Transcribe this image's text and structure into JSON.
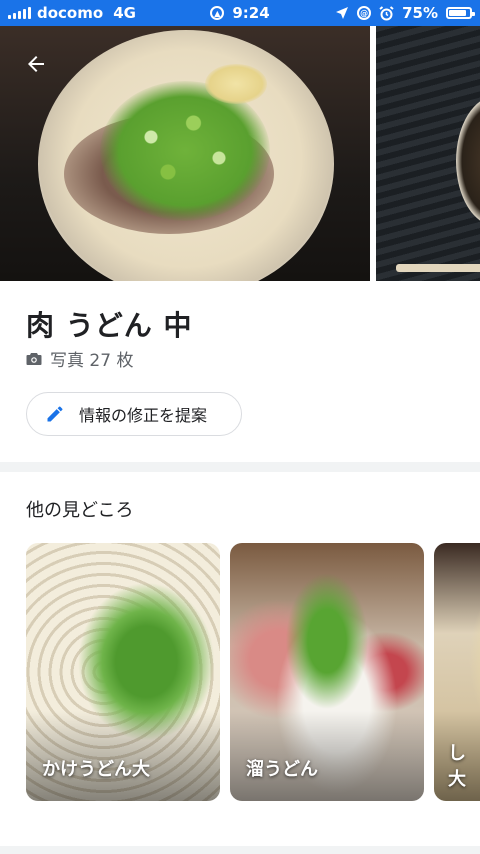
{
  "status_bar": {
    "carrier": "docomo",
    "network": "4G",
    "time": "9:24",
    "battery": "75%",
    "battery_level": 0.75,
    "icons": [
      "signal-bars-icon",
      "nav-arrow-icon",
      "location-arrow-icon",
      "lock-rotation-icon",
      "alarm-icon",
      "battery-icon"
    ]
  },
  "hero": {
    "back_icon": "back-arrow-icon"
  },
  "place": {
    "title": "肉 うどん 中",
    "photos_label": "写真 27 枚",
    "photos_icon": "camera-icon"
  },
  "suggest_button": {
    "label": "情報の修正を提案",
    "icon": "pencil-icon",
    "accent": "#1a73e8"
  },
  "other_spots": {
    "title": "他の見どころ",
    "cards": [
      {
        "label": "かけうどん大"
      },
      {
        "label": "溜うどん"
      },
      {
        "label_line1": "し",
        "label_line2": "大"
      }
    ]
  },
  "colors": {
    "status_bar": "#1a73e8",
    "divider": "#f1f3f4"
  }
}
